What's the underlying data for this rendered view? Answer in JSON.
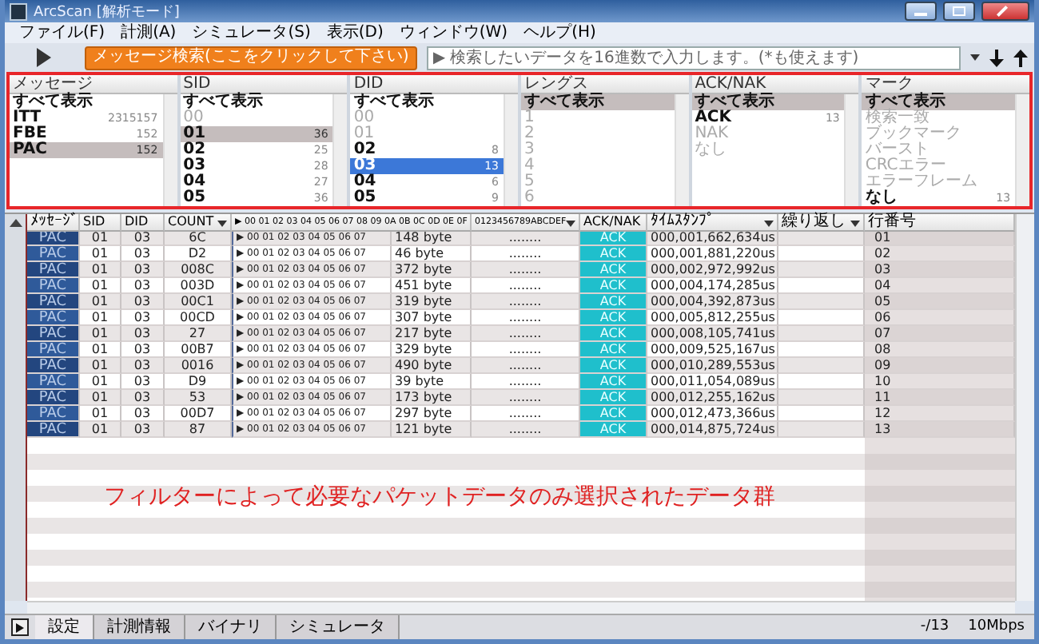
{
  "window": {
    "title": "ArcScan [解析モード]"
  },
  "menu": [
    "ファイル(F)",
    "計測(A)",
    "シミュレータ(S)",
    "表示(D)",
    "ウィンドウ(W)",
    "ヘルプ(H)"
  ],
  "toolbar": {
    "search_button": "メッセージ検索(ここをクリックして下さい)",
    "search": {
      "placeholder": "▶ 検索したいデータを16進数で入力します。(*も使えます)"
    }
  },
  "filters": [
    {
      "title": "メッセージ",
      "focused": false,
      "items": [
        {
          "label": "すべて表示",
          "selected": false,
          "dimmed": false
        },
        {
          "label": "ITT",
          "count": "2315157",
          "selected": false,
          "dimmed": false
        },
        {
          "label": "FBE",
          "count": "152",
          "selected": false,
          "dimmed": false
        },
        {
          "label": "PAC",
          "count": "152",
          "selected": true,
          "dimmed": false
        }
      ]
    },
    {
      "title": "SID",
      "focused": false,
      "items": [
        {
          "label": "すべて表示",
          "selected": false,
          "dimmed": false
        },
        {
          "label": "00",
          "selected": false,
          "dimmed": true
        },
        {
          "label": "01",
          "count": "36",
          "selected": true,
          "dimmed": false
        },
        {
          "label": "02",
          "count": "25",
          "selected": false,
          "dimmed": false
        },
        {
          "label": "03",
          "count": "28",
          "selected": false,
          "dimmed": false
        },
        {
          "label": "04",
          "count": "27",
          "selected": false,
          "dimmed": false
        },
        {
          "label": "05",
          "count": "36",
          "selected": false,
          "dimmed": false
        }
      ]
    },
    {
      "title": "DID",
      "focused": true,
      "items": [
        {
          "label": "すべて表示",
          "selected": false,
          "dimmed": false
        },
        {
          "label": "00",
          "selected": false,
          "dimmed": true
        },
        {
          "label": "01",
          "selected": false,
          "dimmed": true
        },
        {
          "label": "02",
          "count": "8",
          "selected": false,
          "dimmed": false
        },
        {
          "label": "03",
          "count": "13",
          "selected": true,
          "dimmed": false
        },
        {
          "label": "04",
          "count": "6",
          "selected": false,
          "dimmed": false
        },
        {
          "label": "05",
          "count": "9",
          "selected": false,
          "dimmed": false
        }
      ]
    },
    {
      "title": "レングス",
      "focused": false,
      "items": [
        {
          "label": "すべて表示",
          "selected": true,
          "dimmed": false
        },
        {
          "label": "1",
          "selected": false,
          "dimmed": true
        },
        {
          "label": "2",
          "selected": false,
          "dimmed": true
        },
        {
          "label": "3",
          "selected": false,
          "dimmed": true
        },
        {
          "label": "4",
          "selected": false,
          "dimmed": true
        },
        {
          "label": "5",
          "selected": false,
          "dimmed": true
        },
        {
          "label": "6",
          "selected": false,
          "dimmed": true
        }
      ]
    },
    {
      "title": "ACK/NAK",
      "focused": false,
      "items": [
        {
          "label": "すべて表示",
          "selected": true,
          "dimmed": false
        },
        {
          "label": "ACK",
          "count": "13",
          "selected": false,
          "dimmed": false
        },
        {
          "label": "NAK",
          "selected": false,
          "dimmed": true
        },
        {
          "label": "なし",
          "selected": false,
          "dimmed": true
        }
      ]
    },
    {
      "title": "マーク",
      "focused": false,
      "items": [
        {
          "label": "すべて表示",
          "selected": true,
          "dimmed": false
        },
        {
          "label": "検索一致",
          "selected": false,
          "dimmed": true
        },
        {
          "label": "ブックマーク",
          "selected": false,
          "dimmed": true
        },
        {
          "label": "バースト",
          "selected": false,
          "dimmed": true
        },
        {
          "label": "CRCエラー",
          "selected": false,
          "dimmed": true
        },
        {
          "label": "エラーフレーム",
          "selected": false,
          "dimmed": true
        },
        {
          "label": "なし",
          "count": "13",
          "selected": false,
          "dimmed": false
        }
      ]
    }
  ],
  "table": {
    "columns": [
      {
        "label": "ﾒｯｾｰｼﾞ",
        "dropdown": false
      },
      {
        "label": "SID",
        "dropdown": false
      },
      {
        "label": "DID",
        "dropdown": false
      },
      {
        "label": "COUNT",
        "dropdown": true
      },
      {
        "label": "▶ 00 01 02 03 04 05 06 07 08 09 0A 0B 0C 0D 0E 0F",
        "dropdown": false
      },
      {
        "label": "0123456789ABCDEF",
        "dropdown": true
      },
      {
        "label": "ACK/NAK",
        "dropdown": false
      },
      {
        "label": "ﾀｲﾑｽﾀﾝﾌﾟ",
        "dropdown": true
      },
      {
        "label": "繰り返し",
        "dropdown": true
      },
      {
        "label": "行番号",
        "dropdown": false
      }
    ],
    "rows": [
      {
        "message": "PAC",
        "sid": "01",
        "did": "03",
        "count": "6C",
        "hex": "▶ 00 01 02 03 04 05 06 07",
        "size": "148 byte",
        "ascii": "........",
        "ack": "ACK",
        "timestamp": "000,001,662,634us",
        "line": "01"
      },
      {
        "message": "PAC",
        "sid": "01",
        "did": "03",
        "count": "D2",
        "hex": "▶ 00 01 02 03 04 05 06 07",
        "size": "46 byte",
        "ascii": "........",
        "ack": "ACK",
        "timestamp": "000,001,881,220us",
        "line": "02"
      },
      {
        "message": "PAC",
        "sid": "01",
        "did": "03",
        "count": "008C",
        "hex": "▶ 00 01 02 03 04 05 06 07",
        "size": "372 byte",
        "ascii": "........",
        "ack": "ACK",
        "timestamp": "000,002,972,992us",
        "line": "03"
      },
      {
        "message": "PAC",
        "sid": "01",
        "did": "03",
        "count": "003D",
        "hex": "▶ 00 01 02 03 04 05 06 07",
        "size": "451 byte",
        "ascii": "........",
        "ack": "ACK",
        "timestamp": "000,004,174,285us",
        "line": "04"
      },
      {
        "message": "PAC",
        "sid": "01",
        "did": "03",
        "count": "00C1",
        "hex": "▶ 00 01 02 03 04 05 06 07",
        "size": "319 byte",
        "ascii": "........",
        "ack": "ACK",
        "timestamp": "000,004,392,873us",
        "line": "05"
      },
      {
        "message": "PAC",
        "sid": "01",
        "did": "03",
        "count": "00CD",
        "hex": "▶ 00 01 02 03 04 05 06 07",
        "size": "307 byte",
        "ascii": "........",
        "ack": "ACK",
        "timestamp": "000,005,812,255us",
        "line": "06"
      },
      {
        "message": "PAC",
        "sid": "01",
        "did": "03",
        "count": "27",
        "hex": "▶ 00 01 02 03 04 05 06 07",
        "size": "217 byte",
        "ascii": "........",
        "ack": "ACK",
        "timestamp": "000,008,105,741us",
        "line": "07"
      },
      {
        "message": "PAC",
        "sid": "01",
        "did": "03",
        "count": "00B7",
        "hex": "▶ 00 01 02 03 04 05 06 07",
        "size": "329 byte",
        "ascii": "........",
        "ack": "ACK",
        "timestamp": "000,009,525,167us",
        "line": "08"
      },
      {
        "message": "PAC",
        "sid": "01",
        "did": "03",
        "count": "0016",
        "hex": "▶ 00 01 02 03 04 05 06 07",
        "size": "490 byte",
        "ascii": "........",
        "ack": "ACK",
        "timestamp": "000,010,289,553us",
        "line": "09"
      },
      {
        "message": "PAC",
        "sid": "01",
        "did": "03",
        "count": "D9",
        "hex": "▶ 00 01 02 03 04 05 06 07",
        "size": "39 byte",
        "ascii": "........",
        "ack": "ACK",
        "timestamp": "000,011,054,089us",
        "line": "10"
      },
      {
        "message": "PAC",
        "sid": "01",
        "did": "03",
        "count": "53",
        "hex": "▶ 00 01 02 03 04 05 06 07",
        "size": "173 byte",
        "ascii": "........",
        "ack": "ACK",
        "timestamp": "000,012,255,162us",
        "line": "11"
      },
      {
        "message": "PAC",
        "sid": "01",
        "did": "03",
        "count": "00D7",
        "hex": "▶ 00 01 02 03 04 05 06 07",
        "size": "297 byte",
        "ascii": "........",
        "ack": "ACK",
        "timestamp": "000,012,473,366us",
        "line": "12"
      },
      {
        "message": "PAC",
        "sid": "01",
        "did": "03",
        "count": "87",
        "hex": "▶ 00 01 02 03 04 05 06 07",
        "size": "121 byte",
        "ascii": "........",
        "ack": "ACK",
        "timestamp": "000,014,875,724us",
        "line": "13"
      }
    ]
  },
  "annotation": "フィルターによって必要なパケットデータのみ選択されたデータ群",
  "tabs": [
    {
      "label": "設定",
      "selected": true
    },
    {
      "label": "計測情報",
      "selected": false
    },
    {
      "label": "バイナリ",
      "selected": false
    },
    {
      "label": "シミュレータ",
      "selected": false
    }
  ],
  "status": [
    "-/13",
    "10Mbps"
  ]
}
